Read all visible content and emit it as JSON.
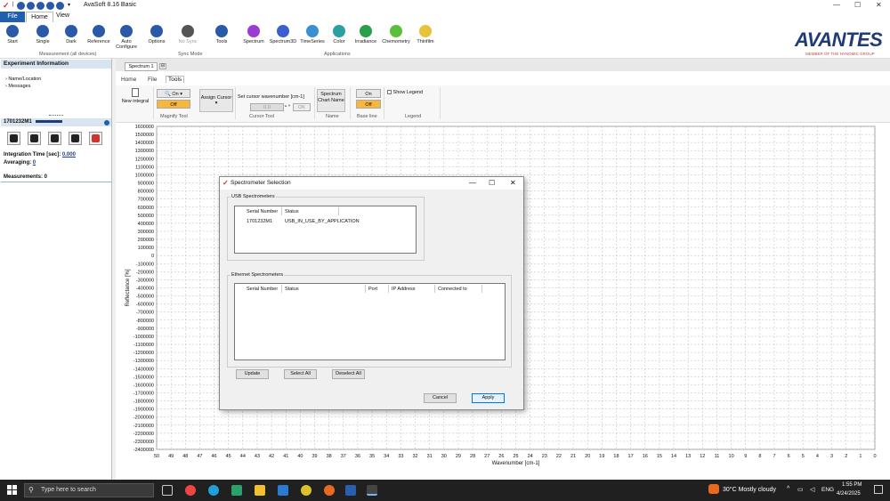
{
  "window": {
    "title": "AvaSoft 8.16 Basic",
    "controls": [
      "—",
      "☐",
      "✕"
    ]
  },
  "menu": {
    "file": "File",
    "home": "Home",
    "view": "View"
  },
  "ribbon": {
    "buttons": [
      {
        "label": "Start",
        "color": "#2a59a8"
      },
      {
        "label": "Single",
        "color": "#2a59a8"
      },
      {
        "label": "Dark",
        "color": "#2a59a8"
      },
      {
        "label": "Reference",
        "color": "#2a59a8"
      },
      {
        "label": "Auto Configure",
        "color": "#2a59a8"
      },
      {
        "label": "Options",
        "color": "#2a59a8"
      },
      {
        "label": "No Sync",
        "color": "#555555"
      },
      {
        "label": "Tools",
        "color": "#2a59a8"
      },
      {
        "label": "Spectrum",
        "color": "#9b3bd1"
      },
      {
        "label": "Spectrum3D",
        "color": "#3b5fd1"
      },
      {
        "label": "TimeSeries",
        "color": "#3b8fd1"
      },
      {
        "label": "Color",
        "color": "#2aa0a0"
      },
      {
        "label": "Irradiance",
        "color": "#2aa04a"
      },
      {
        "label": "Chemometry",
        "color": "#5ac03b"
      },
      {
        "label": "Thinfilm",
        "color": "#e8c23b"
      }
    ],
    "groups": {
      "measurement": "Measurement (all devices)",
      "sync": "Sync Mode",
      "applications": "Applications"
    }
  },
  "logo": {
    "text": "AVANTES",
    "sub": "MEMBER OF THE NYNOMIC GROUP"
  },
  "experiment": {
    "title": "Experiment Information",
    "items": [
      "Name/Location",
      "Messages"
    ]
  },
  "device": {
    "name": "1701232M1",
    "integration_label": "Integration Time [sec]:",
    "integration_value": "0.000",
    "averaging_label": "Averaging:",
    "averaging_value": "0",
    "measurements": "Measurements: 0"
  },
  "tabs": {
    "spectrum": "Spectrum 1",
    "sub": [
      "Home",
      "File",
      "Tools"
    ]
  },
  "tools": {
    "new_integral": "New integral",
    "magnify_on": "On",
    "magnify_off": "Off",
    "magnify_group": "Magnify Tool",
    "assign_cursor": "Assign Cursor",
    "set_cursor_label": "Set cursor wavenumber [cm-1]",
    "cursor_value": "0.0",
    "ok": "OK",
    "cursor_group": "Cursor Tool",
    "chart_name": "Spectrum Chart Name",
    "name_group": "Name",
    "baseline_on": "On",
    "baseline_off": "Off",
    "baseline_group": "Base line",
    "show_legend": "Show Legend",
    "legend_group": "Legend"
  },
  "chart_data": {
    "type": "line",
    "xlabel": "Wavenumber [cm-1]",
    "ylabel": "Reflectance [%]",
    "x_ticks": [
      "50",
      "49",
      "48",
      "47",
      "46",
      "45",
      "44",
      "43",
      "42",
      "41",
      "40",
      "39",
      "38",
      "37",
      "36",
      "35",
      "34",
      "33",
      "32",
      "31",
      "30",
      "29",
      "28",
      "27",
      "26",
      "25",
      "24",
      "23",
      "22",
      "21",
      "20",
      "19",
      "18",
      "17",
      "16",
      "15",
      "14",
      "13",
      "12",
      "11",
      "10",
      "9",
      "8",
      "7",
      "6",
      "5",
      "4",
      "3",
      "2",
      "1",
      "0"
    ],
    "y_ticks": [
      "1600000",
      "1500000",
      "1400000",
      "1300000",
      "1200000",
      "1100000",
      "1000000",
      "900000",
      "800000",
      "700000",
      "600000",
      "500000",
      "400000",
      "300000",
      "200000",
      "100000",
      "0",
      "-100000",
      "-200000",
      "-300000",
      "-400000",
      "-500000",
      "-600000",
      "-700000",
      "-800000",
      "-900000",
      "-1000000",
      "-1100000",
      "-1200000",
      "-1300000",
      "-1400000",
      "-1500000",
      "-1600000",
      "-1700000",
      "-1800000",
      "-1900000",
      "-2000000",
      "-2100000",
      "-2200000",
      "-2300000",
      "-2400000"
    ],
    "xlim": [
      50,
      0
    ],
    "ylim": [
      -2400000,
      1600000
    ],
    "grid": true,
    "series": []
  },
  "dialog": {
    "title": "Spectrometer Selection",
    "usb_label": "USB Spectrometers",
    "usb_columns": [
      "Serial Number",
      "Status"
    ],
    "usb_rows": [
      [
        "1701232M1",
        "USB_IN_USE_BY_APPLICATION"
      ]
    ],
    "eth_label": "Ethernet Spectrometers",
    "eth_columns": [
      "Serial Number",
      "Status",
      "Port",
      "IP Address",
      "Connected to"
    ],
    "update": "Update",
    "select_all": "Select All",
    "deselect_all": "Deselect All",
    "cancel": "Cancel",
    "apply": "Apply"
  },
  "taskbar": {
    "search": "Type here to search",
    "weather": "30°C  Mostly cloudy",
    "lang": "ENG",
    "time": "1:55 PM",
    "date": "4/24/2025"
  }
}
